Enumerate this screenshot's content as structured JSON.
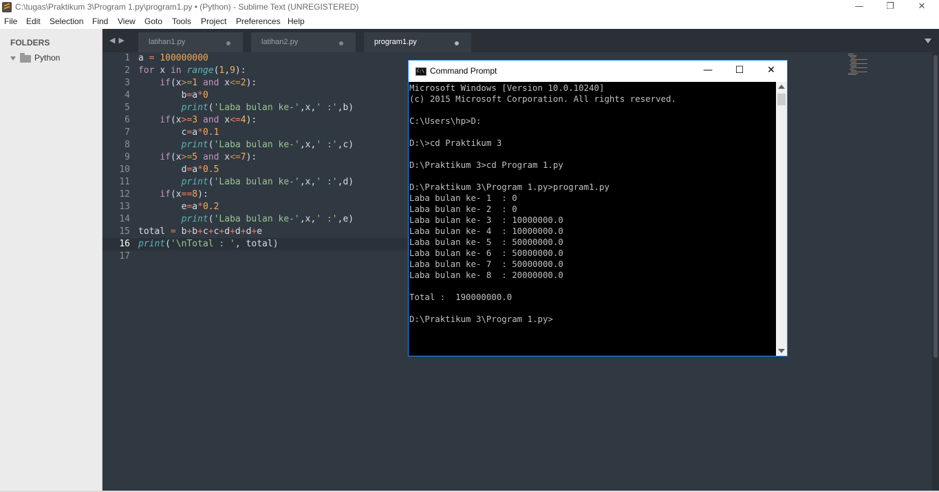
{
  "window": {
    "title": "C:\\tugas\\Praktikum 3\\Program 1.py\\program1.py • (Python) - Sublime Text (UNREGISTERED)",
    "minimize_glyph": "—",
    "restore_glyph": "❐",
    "close_glyph": "✕"
  },
  "menu": [
    "File",
    "Edit",
    "Selection",
    "Find",
    "View",
    "Goto",
    "Tools",
    "Project",
    "Preferences",
    "Help"
  ],
  "sidebar": {
    "header": "FOLDERS",
    "folder": "Python"
  },
  "tabs": {
    "nav_glyph": "◀▶",
    "items": [
      {
        "label": "latihan1.py",
        "active": false
      },
      {
        "label": "latihan2.py",
        "active": false
      },
      {
        "label": "program1.py",
        "active": true
      }
    ]
  },
  "editor": {
    "line_numbers": [
      "1",
      "2",
      "3",
      "4",
      "5",
      "6",
      "7",
      "8",
      "9",
      "10",
      "11",
      "12",
      "13",
      "14",
      "15",
      "16",
      "17"
    ],
    "current_line": 16,
    "code_lines": [
      "a = 100000000",
      "for x in range(1,9):",
      "    if(x>=1 and x<=2):",
      "        b=a*0",
      "        print('Laba bulan ke-',x,' :',b)",
      "    if(x>=3 and x<=4):",
      "        c=a*0.1",
      "        print('Laba bulan ke-',x,' :',c)",
      "    if(x>=5 and x<=7):",
      "        d=a*0.5",
      "        print('Laba bulan ke-',x,' :',d)",
      "    if(x==8):",
      "        e=a*0.2",
      "        print('Laba bulan ke-',x,' :',e)",
      "total = b+b+c+c+d+d+d+e",
      "print('\\nTotal : ', total)",
      ""
    ],
    "colors": {
      "background": "#303841",
      "keyword": "#c695c6",
      "operator": "#f97b58",
      "number": "#f9ae58",
      "string": "#99c794",
      "function": "#5fb4b4"
    }
  },
  "cmd": {
    "title": "Command Prompt",
    "minimize_glyph": "—",
    "maximize_glyph": "☐",
    "close_glyph": "✕",
    "lines": [
      "Microsoft Windows [Version 10.0.10240]",
      "(c) 2015 Microsoft Corporation. All rights reserved.",
      "",
      "C:\\Users\\hp>D:",
      "",
      "D:\\>cd Praktikum 3",
      "",
      "D:\\Praktikum 3>cd Program 1.py",
      "",
      "D:\\Praktikum 3\\Program 1.py>program1.py",
      "Laba bulan ke- 1  : 0",
      "Laba bulan ke- 2  : 0",
      "Laba bulan ke- 3  : 10000000.0",
      "Laba bulan ke- 4  : 10000000.0",
      "Laba bulan ke- 5  : 50000000.0",
      "Laba bulan ke- 6  : 50000000.0",
      "Laba bulan ke- 7  : 50000000.0",
      "Laba bulan ke- 8  : 20000000.0",
      "",
      "Total :  190000000.0",
      "",
      "D:\\Praktikum 3\\Program 1.py>"
    ]
  }
}
